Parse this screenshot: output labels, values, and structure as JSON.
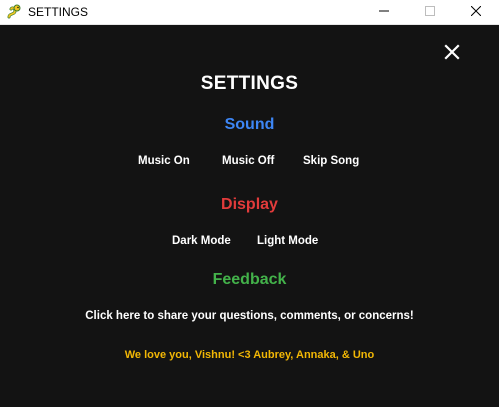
{
  "window": {
    "title": "SETTINGS",
    "app_icon": "pygame-snake-icon",
    "controls": [
      "minimize-icon",
      "maximize-icon",
      "close-icon"
    ]
  },
  "page": {
    "title": "SETTINGS",
    "close_icon": "x-icon",
    "background_color": "#131313"
  },
  "sound": {
    "heading": "Sound",
    "heading_color": "#3d86f5",
    "music_on": "Music On",
    "music_off": "Music Off",
    "skip_song": "Skip Song"
  },
  "display": {
    "heading": "Display",
    "heading_color": "#e23b3b",
    "dark_mode": "Dark Mode",
    "light_mode": "Light Mode"
  },
  "feedback": {
    "heading": "Feedback",
    "heading_color": "#43b24a",
    "link": "Click here to share your questions, comments, or concerns!"
  },
  "credits": {
    "text": "We love you, Vishnu! <3 Aubrey, Annaka, & Uno",
    "color": "#f2b705"
  }
}
